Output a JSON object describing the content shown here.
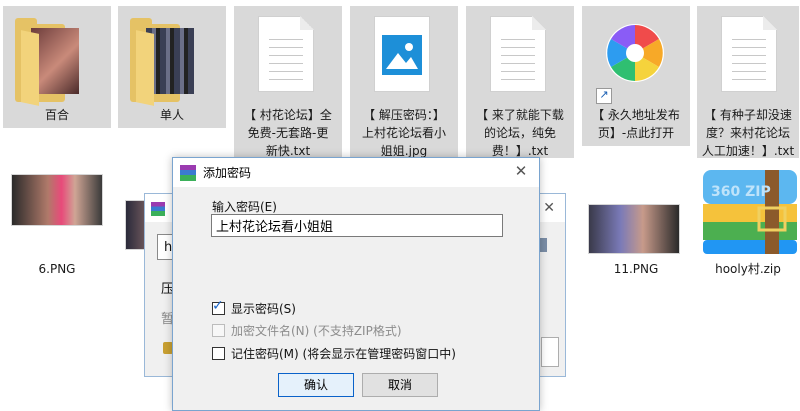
{
  "files_top": [
    {
      "name": "百合",
      "type": "folder"
    },
    {
      "name": "单人",
      "type": "folder"
    },
    {
      "name": "【 村花论坛】全\n免费-无套路-更\n新快.txt",
      "type": "txt"
    },
    {
      "name": "【 解压密码：】\n上村花论坛看小\n姐姐.jpg",
      "type": "jpg"
    },
    {
      "name": "【 来了就能下载\n的论坛，纯免\n费！】.txt",
      "type": "txt"
    },
    {
      "name": "【 永久地址发布\n页】-点此打开",
      "type": "shortcut"
    },
    {
      "name": "【 有种子却没速\n度？来村花论坛\n人工加速！】.txt",
      "type": "txt"
    }
  ],
  "files_bottom": [
    {
      "name": "6.PNG",
      "type": "png"
    },
    {
      "name": "11.PNG",
      "type": "png"
    },
    {
      "name": "hooly村.zip",
      "type": "zip"
    }
  ],
  "bg_dialog": {
    "fragments": [
      "h",
      "压",
      "暂"
    ],
    "zip_badge": "360 ZIP"
  },
  "dialog": {
    "title": "添加密码",
    "password_label": "输入密码(E)",
    "password_value": "上村花论坛看小姐姐",
    "options": [
      {
        "label": "显示密码(S)",
        "checked": true,
        "enabled": true
      },
      {
        "label": "加密文件名(N) (不支持ZIP格式)",
        "checked": false,
        "enabled": false
      },
      {
        "label": "记住密码(M) (将会显示在管理密码窗口中)",
        "checked": false,
        "enabled": true
      }
    ],
    "ok_label": "确认",
    "cancel_label": "取消",
    "close_glyph": "✕"
  },
  "colors": {
    "selection": "#d9d9d9",
    "dialog_border": "#7aa4cf",
    "accent_check": "#1b66c9"
  }
}
